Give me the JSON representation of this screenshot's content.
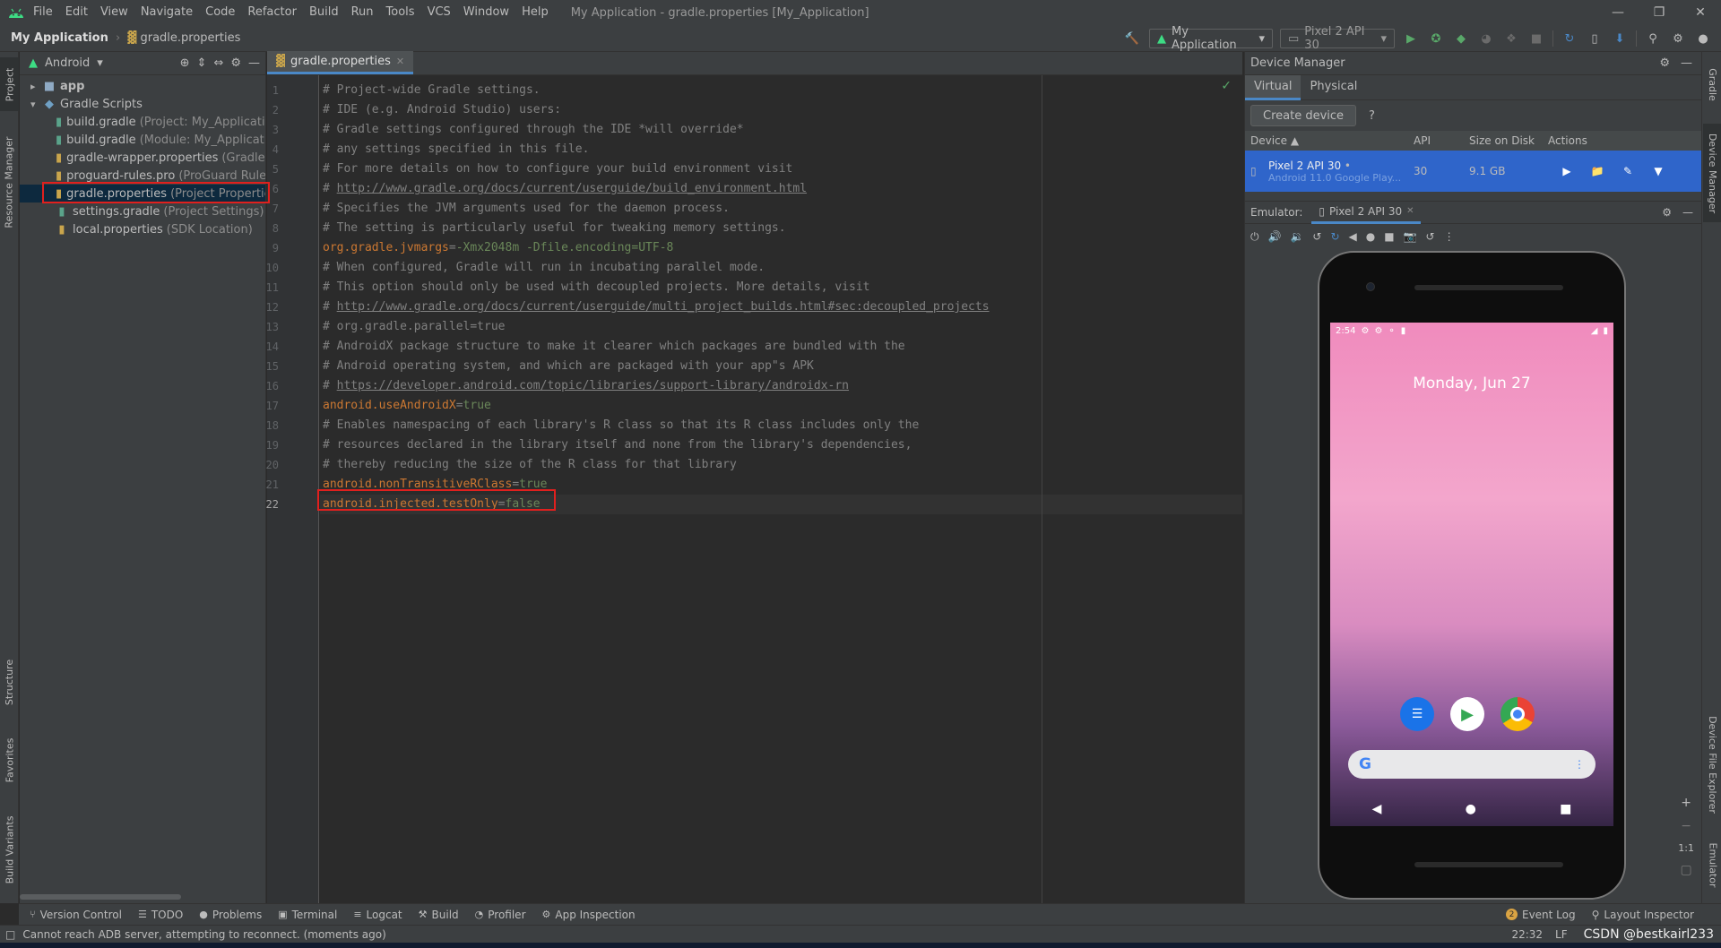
{
  "menu": [
    "File",
    "Edit",
    "View",
    "Navigate",
    "Code",
    "Refactor",
    "Build",
    "Run",
    "Tools",
    "VCS",
    "Window",
    "Help"
  ],
  "window_title": "My Application - gradle.properties [My_Application]",
  "breadcrumb": {
    "project": "My Application",
    "file": "gradle.properties"
  },
  "toolbar": {
    "run_config": "My Application",
    "device": "Pixel 2 API 30"
  },
  "left_stripe": {
    "project": "Project",
    "resource_manager": "Resource Manager",
    "structure": "Structure",
    "favorites": "Favorites",
    "build_variants": "Build Variants"
  },
  "project_panel": {
    "view": "Android",
    "tree": [
      {
        "label": "app",
        "sub": ""
      },
      {
        "label": "Gradle Scripts",
        "sub": ""
      },
      {
        "label": "build.gradle",
        "sub": "(Project: My_Application)"
      },
      {
        "label": "build.gradle",
        "sub": "(Module: My_Application"
      },
      {
        "label": "gradle-wrapper.properties",
        "sub": "(Gradle V"
      },
      {
        "label": "proguard-rules.pro",
        "sub": "(ProGuard Rules"
      },
      {
        "label": "gradle.properties",
        "sub": "(Project Properties"
      },
      {
        "label": "settings.gradle",
        "sub": "(Project Settings)"
      },
      {
        "label": "local.properties",
        "sub": "(SDK Location)"
      }
    ]
  },
  "editor": {
    "tab": "gradle.properties",
    "lines": [
      {
        "n": "1",
        "t": "comment",
        "text": "# Project-wide Gradle settings."
      },
      {
        "n": "2",
        "t": "comment",
        "text": "# IDE (e.g. Android Studio) users:"
      },
      {
        "n": "3",
        "t": "comment",
        "text": "# Gradle settings configured through the IDE *will override*"
      },
      {
        "n": "4",
        "t": "comment",
        "text": "# any settings specified in this file."
      },
      {
        "n": "5",
        "t": "comment",
        "text": "# For more details on how to configure your build environment visit"
      },
      {
        "n": "6",
        "t": "link",
        "prefix": "# ",
        "text": "http://www.gradle.org/docs/current/userguide/build_environment.html"
      },
      {
        "n": "7",
        "t": "comment",
        "text": "# Specifies the JVM arguments used for the daemon process."
      },
      {
        "n": "8",
        "t": "comment",
        "text": "# The setting is particularly useful for tweaking memory settings."
      },
      {
        "n": "9",
        "t": "prop",
        "key": "org.gradle.jvmargs",
        "value": "-Xmx2048m -Dfile.encoding=UTF-8"
      },
      {
        "n": "10",
        "t": "comment",
        "text": "# When configured, Gradle will run in incubating parallel mode."
      },
      {
        "n": "11",
        "t": "comment",
        "text": "# This option should only be used with decoupled projects. More details, visit"
      },
      {
        "n": "12",
        "t": "link",
        "prefix": "# ",
        "text": "http://www.gradle.org/docs/current/userguide/multi_project_builds.html#sec:decoupled_projects"
      },
      {
        "n": "13",
        "t": "comment",
        "text": "# org.gradle.parallel=true"
      },
      {
        "n": "14",
        "t": "comment",
        "text": "# AndroidX package structure to make it clearer which packages are bundled with the"
      },
      {
        "n": "15",
        "t": "comment",
        "text": "# Android operating system, and which are packaged with your app\"s APK"
      },
      {
        "n": "16",
        "t": "link",
        "prefix": "# ",
        "text": "https://developer.android.com/topic/libraries/support-library/androidx-rn"
      },
      {
        "n": "17",
        "t": "prop",
        "key": "android.useAndroidX",
        "value": "true"
      },
      {
        "n": "18",
        "t": "comment",
        "text": "# Enables namespacing of each library's R class so that its R class includes only the"
      },
      {
        "n": "19",
        "t": "comment",
        "text": "# resources declared in the library itself and none from the library's dependencies,"
      },
      {
        "n": "20",
        "t": "comment",
        "text": "# thereby reducing the size of the R class for that library"
      },
      {
        "n": "21",
        "t": "prop",
        "key": "android.nonTransitiveRClass",
        "value": "true"
      },
      {
        "n": "22",
        "t": "prop",
        "key": "android.injected.testOnly",
        "value": "false"
      }
    ]
  },
  "device_manager": {
    "title": "Device Manager",
    "tabs": [
      "Virtual",
      "Physical"
    ],
    "create_button": "Create device",
    "help": "?",
    "columns": [
      "Device",
      "API",
      "Size on Disk",
      "Actions"
    ],
    "device": {
      "name": "Pixel 2 API 30",
      "detail": "Android 11.0 Google Play...",
      "api": "30",
      "size": "9.1 GB"
    }
  },
  "emulator": {
    "label": "Emulator:",
    "tab": "Pixel 2 API 30",
    "time": "2:54",
    "date": "Monday, Jun 27",
    "zoom_ratio": "1:1"
  },
  "right_stripe": {
    "gradle": "Gradle",
    "device_manager": "Device Manager",
    "device_file_explorer": "Device File Explorer",
    "emulator": "Emulator"
  },
  "bottom_tabs": [
    "Version Control",
    "TODO",
    "Problems",
    "Terminal",
    "Logcat",
    "Build",
    "Profiler",
    "App Inspection"
  ],
  "event_log": {
    "count": "2",
    "label": "Event Log"
  },
  "layout_inspector": "Layout Inspector",
  "status": {
    "message": "Cannot reach ADB server, attempting to reconnect. (moments ago)",
    "time": "22:32",
    "line_sep": "LF",
    "watermark": "CSDN @bestkairl233"
  },
  "colors": {
    "accent": "#4a88c7",
    "highlight_box": "#e0201e",
    "comment": "#808080",
    "key": "#cc7832",
    "value": "#6a8759"
  }
}
